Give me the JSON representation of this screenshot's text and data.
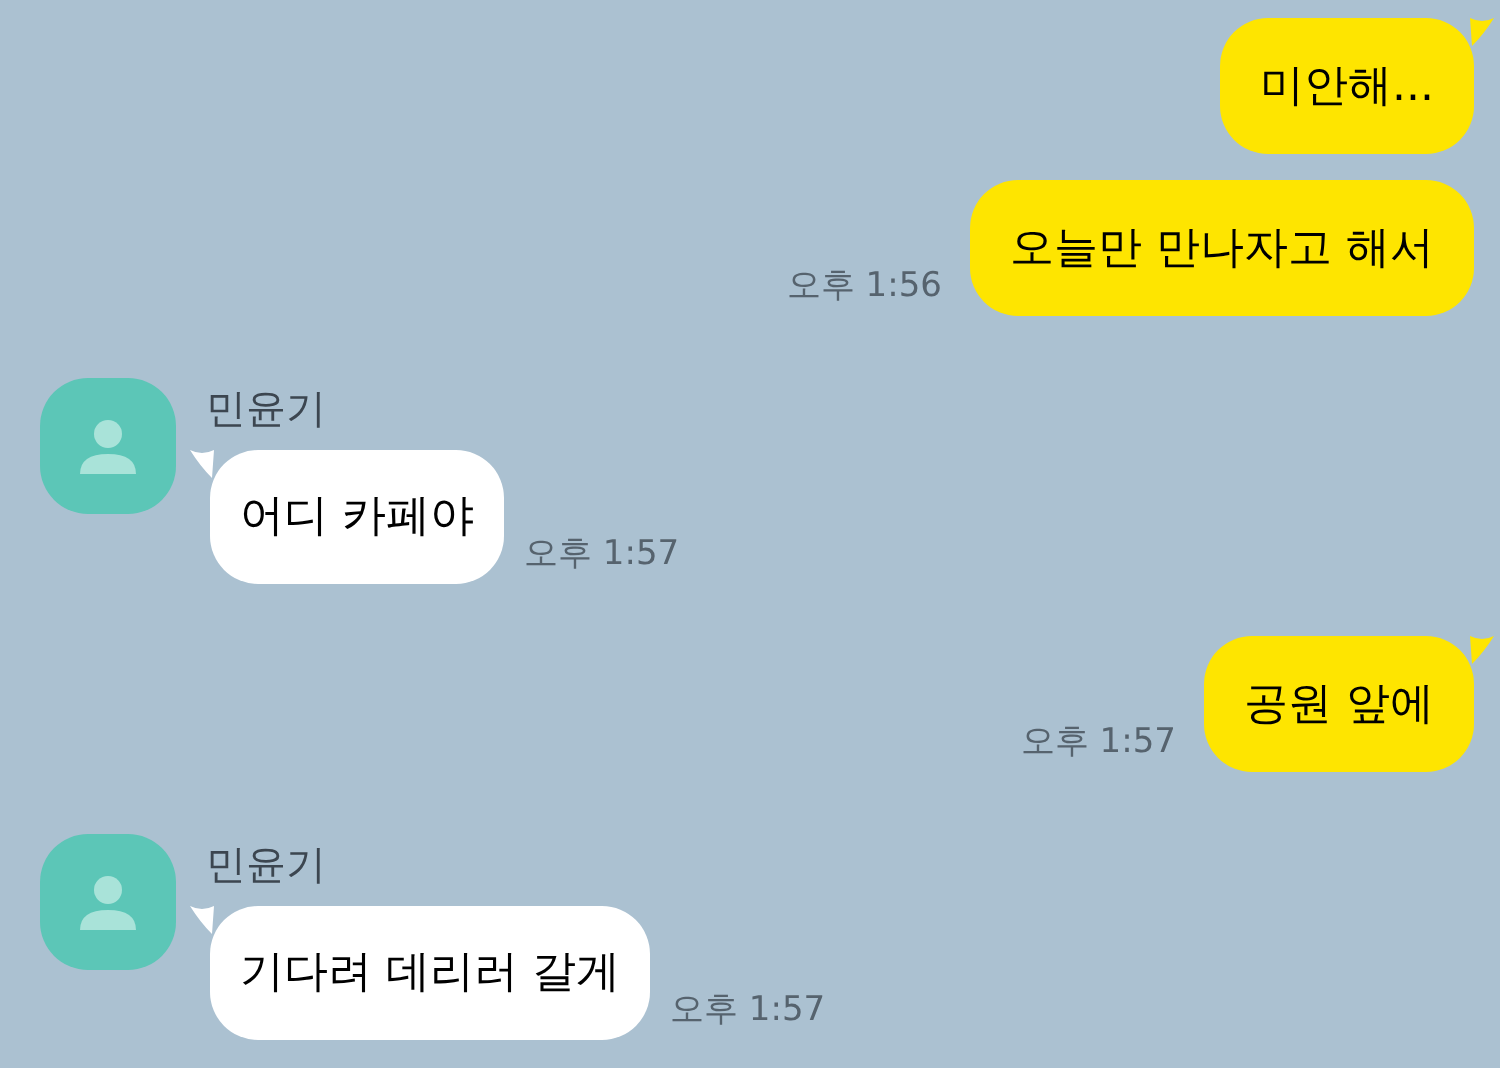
{
  "messages": [
    {
      "kind": "sent",
      "text": "미안해...",
      "tail": true
    },
    {
      "kind": "sent",
      "text": "오늘만 만나자고 해서",
      "time": "오후 1:56",
      "tail": false
    },
    {
      "kind": "received",
      "name": "민윤기",
      "text": "어디 카페야",
      "time": "오후 1:57",
      "tail": true
    },
    {
      "kind": "sent",
      "text": "공원 앞에",
      "time": "오후 1:57",
      "tail": true
    },
    {
      "kind": "received",
      "name": "민윤기",
      "text": "기다려 데리러 갈게",
      "time": "오후 1:57",
      "tail": true
    }
  ]
}
